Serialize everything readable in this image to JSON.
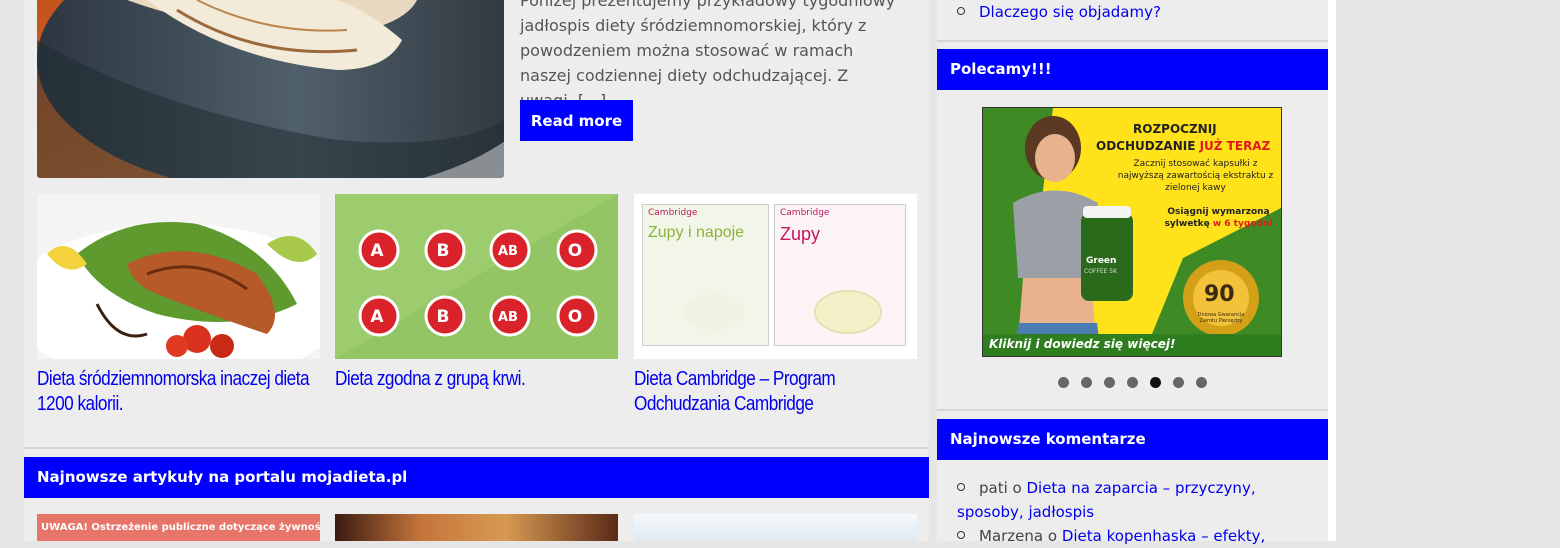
{
  "featured": {
    "excerpt": "Poniżej prezentujemy przykładowy tygodniowy jadłospis diety śródziemnomorskiej, który z powodzeniem można stosować w ramach naszej codziennej diety odchudzającej. Z uwagi, […]",
    "read_more": "Read more"
  },
  "cards": [
    {
      "title": "Dieta śródziemnomorska inaczej dieta 1200 kalorii."
    },
    {
      "title": "Dieta zgodna z grupą krwi."
    },
    {
      "title": "Dieta Cambridge – Program Odchudzania Cambridge"
    }
  ],
  "blood_types": [
    "A",
    "B",
    "AB",
    "O"
  ],
  "cambridge": {
    "brand": "Cambridge",
    "box1": "Zupy i napoje",
    "box2": "Zupy"
  },
  "section_title": "Najnowsze artykuły na portalu mojadieta.pl",
  "bottom_banner": "UWAGA! Ostrzeżenie publiczne dotyczące żywności!",
  "sidebar": {
    "top_link": "Dlaczego się objadamy?",
    "recommend_title": "Polecamy!!!",
    "ad": {
      "line1": "ROZPOCZNIJ",
      "line2a": "ODCHUDZANIE ",
      "line2b": "JUŻ TERAZ",
      "body": "Zacznij stosować kapsułki z najwyższą zawartością ekstraktu z zielonej kawy",
      "goal_a": "Osiągnij wymarzoną sylwetkę ",
      "goal_b": "w 6 tygodni",
      "product": "Green",
      "product2": "COFFEE 5K",
      "seal_num": "90",
      "seal_text": "Dniowa Gwarancja Zwrotu Pieniędzy",
      "cta": "Kliknij i dowiedz się więcej!"
    },
    "comments_title": "Najnowsze komentarze",
    "comments": [
      {
        "author": "pati",
        "sep": " o ",
        "link": "Dieta na zaparcia – przyczyny, sposoby, jadłospis"
      },
      {
        "author": "Marzena",
        "sep": " o ",
        "link": "Dieta kopenhaska – efekty,"
      }
    ]
  },
  "colors": {
    "accent": "#0000ff",
    "link": "#0000ee"
  }
}
